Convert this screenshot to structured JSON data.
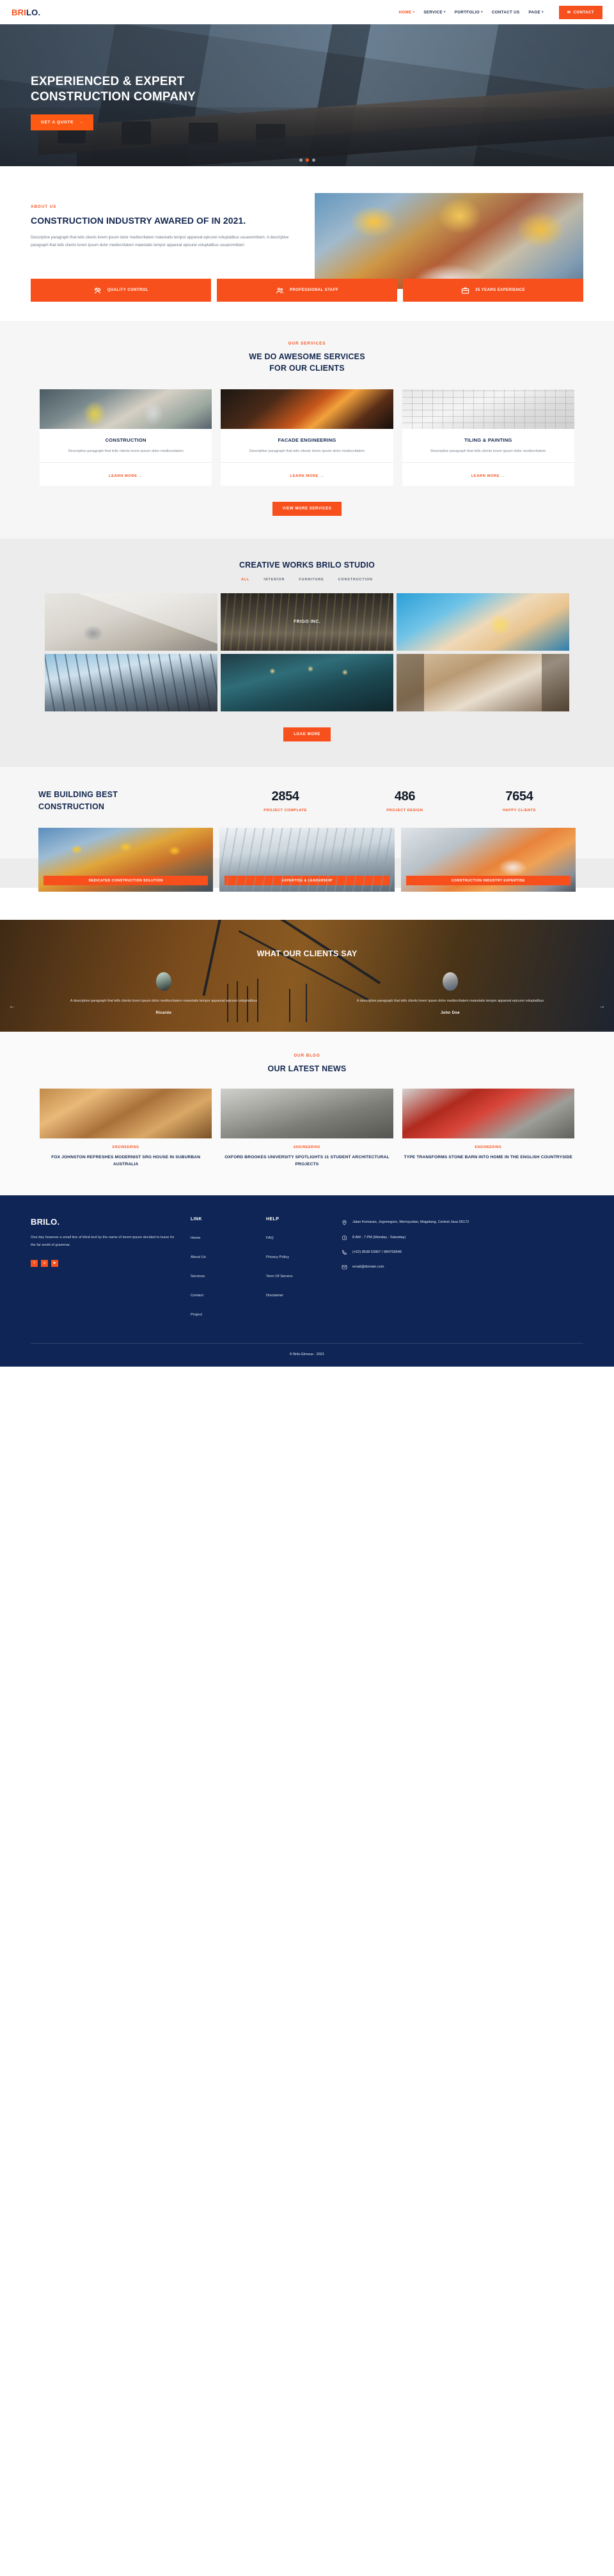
{
  "header": {
    "logo_bri": "BRI",
    "logo_lo": "LO.",
    "nav": [
      {
        "label": "HOME",
        "caret": true,
        "active": true
      },
      {
        "label": "SERVICE",
        "caret": true,
        "active": false
      },
      {
        "label": "PORTFOLIO",
        "caret": true,
        "active": false
      },
      {
        "label": "CONTACT US",
        "caret": false,
        "active": false
      },
      {
        "label": "PAGE",
        "caret": true,
        "active": false
      }
    ],
    "contact_button": "CONTACT",
    "contact_icon": "envelope-icon"
  },
  "hero": {
    "title_line1": "EXPERIENCED & EXPERT",
    "title_line2": "CONSTRUCTION COMPANY",
    "cta": "GET A QUOTE",
    "cta_icon": "arrow-right-icon",
    "dots": 3,
    "active_dot": 1
  },
  "about": {
    "eyebrow": "ABOUT US",
    "title": "CONSTRUCTION INDUSTRY AWARED OF IN 2021.",
    "paragraph": "Descriptive paragraph that tells clients lorem ipsum dolor mediocritatem maiestatis tempor appareat epicurei voluptatibus usuanomittam. A descriptive paragraph that tells clients lorem ipsum dolor mediocritatem maiestatis tempor appareat epicurei voluptatibus usuanomittam",
    "features": [
      {
        "label": "QUALITY CONTROL",
        "icon": "tools-icon"
      },
      {
        "label": "PROFESSIONAL STAFF",
        "icon": "people-icon"
      },
      {
        "label": "25 YEARS EXPERIENCE",
        "icon": "briefcase-icon"
      }
    ]
  },
  "services": {
    "eyebrow": "OUR SERVICES",
    "title_line1": "WE DO AWESOME SERVICES",
    "title_line2": "FOR OUR CLIENTS",
    "cards": [
      {
        "title": "CONSTRUCTION",
        "desc": "Descriptive paragraph that tells clients lorem ipsum dolor mediocritatem",
        "link": "LEARN MORE"
      },
      {
        "title": "FACADE ENGINEERING",
        "desc": "Descriptive paragraph that tells clients lorem ipsum dolor mediocritatem",
        "link": "LEARN MORE"
      },
      {
        "title": "TILING & PAINTING",
        "desc": "Descriptive paragraph that tells clients lorem ipsum dolor mediocritatem",
        "link": "LEARN MORE"
      }
    ],
    "more_button": "VIEW MORE SERVICES"
  },
  "portfolio": {
    "title": "CREATIVE WORKS BRILO STUDIO",
    "filters": [
      {
        "label": "ALL",
        "active": true
      },
      {
        "label": "INTERIOR",
        "active": false
      },
      {
        "label": "FURNITURE",
        "active": false
      },
      {
        "label": "CONSTRUCTION",
        "active": false
      }
    ],
    "items": [
      {
        "caption": ""
      },
      {
        "caption": "FRIGO INC."
      },
      {
        "caption": ""
      },
      {
        "caption": ""
      },
      {
        "caption": ""
      },
      {
        "caption": ""
      }
    ],
    "load_more": "LOAD MORE"
  },
  "stats": {
    "heading_line1": "WE BUILDING BEST",
    "heading_line2": "CONSTRUCTION",
    "counters": [
      {
        "value": "2854",
        "label": "PROJECT COMPLATE"
      },
      {
        "value": "486",
        "label": "PROJECT DESIGN"
      },
      {
        "value": "7654",
        "label": "HAPPY CLIENTS"
      }
    ],
    "badges": [
      "DEDICATED CONSTRUCTION SOLUTION",
      "EXPERTISE & LEADERSHIP",
      "CONSTRUCTION INDUSTRY EXPERTISE"
    ]
  },
  "testimonials": {
    "title": "WHAT OUR CLIENTS SAY",
    "prev_icon": "arrow-left-icon",
    "next_icon": "arrow-right-icon",
    "items": [
      {
        "quote": "A descriptive paragraph that tells clients lorem ipsum dolor mediocritatem maiestatis tempor appareat epicurei voluptatibus",
        "name": "Ricardo"
      },
      {
        "quote": "A descriptive paragraph that tells clients lorem ipsum dolor mediocritatem maiestatis tempor appareat epicurei voluptatibus",
        "name": "John Doe"
      }
    ]
  },
  "blog": {
    "eyebrow": "OUR BLOG",
    "title": "OUR LATEST NEWS",
    "posts": [
      {
        "category": "ENGINEERING",
        "title": "FOX JOHNSTON REFRESHES MODERNIST SRG HOUSE IN SUBURBAN AUSTRALIA"
      },
      {
        "category": "ENGINEERING",
        "title": "OXFORD BROOKES UNIVERSITY SPOTLIGHTS 11 STUDENT ARCHITECTURAL PROJECTS"
      },
      {
        "category": "ENGINEERING",
        "title": "TYPE TRANSFORMS STONE BARN INTO HOME IN THE ENGLISH COUNTRYSIDE"
      }
    ]
  },
  "footer": {
    "logo": "BRILO.",
    "about": "One day however a small line of blind text by the name of lorem ipsum decided to leave for the far world of grammar.",
    "social": [
      {
        "name": "facebook-icon",
        "glyph": "f"
      },
      {
        "name": "instagram-icon",
        "glyph": "◎"
      },
      {
        "name": "youtube-icon",
        "glyph": "▶"
      }
    ],
    "link_col": {
      "heading": "LINK",
      "items": [
        "Home",
        "About Us",
        "Services",
        "Contact",
        "Project"
      ]
    },
    "help_col": {
      "heading": "HELP",
      "items": [
        "FAQ",
        "Privacy Policy",
        "Term Of Service",
        "Disclaimer"
      ]
    },
    "contact": [
      {
        "icon": "location-pin-icon",
        "text": "Jalan Kemaran, Jogonegoro, Mertoyudan, Magelang, Central Java 56172"
      },
      {
        "icon": "clock-icon",
        "text": "8 AM - 7 PM (Monday - Saturday)"
      },
      {
        "icon": "phone-icon",
        "text": "(+62) 8538 53967 / 984759546"
      },
      {
        "icon": "mail-icon",
        "text": "email@domain.com"
      }
    ],
    "copyright": "© Brilo Elmous - 2021"
  },
  "colors": {
    "accent": "#f8501c",
    "navy": "#12264f",
    "footer_bg": "#0e2555"
  }
}
